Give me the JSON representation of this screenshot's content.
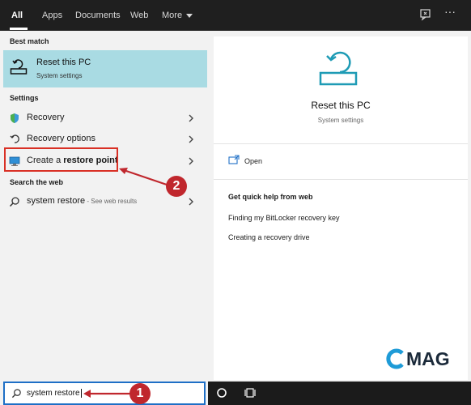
{
  "tabs": [
    {
      "label": "All",
      "active": true
    },
    {
      "label": "Apps",
      "active": false
    },
    {
      "label": "Documents",
      "active": false
    },
    {
      "label": "Web",
      "active": false
    },
    {
      "label": "More",
      "active": false
    }
  ],
  "top_icons": [
    "feedback-icon",
    "more-options-icon"
  ],
  "top_more_icon_text": "···",
  "left": {
    "best_match_heading": "Best match",
    "best_match": {
      "title": "Reset this PC",
      "subtitle": "System settings",
      "icon": "reset-pc-icon"
    },
    "settings_heading": "Settings",
    "settings_items": [
      {
        "label": "Recovery",
        "icon": "recovery-shield-icon"
      },
      {
        "label": "Recovery options",
        "icon": "recovery-options-icon"
      },
      {
        "label_prefix": "Create a ",
        "label_bold": "restore point",
        "icon": "system-properties-icon"
      }
    ],
    "web_heading": "Search the web",
    "web_item": {
      "label": "system restore",
      "suffix": " - See web results",
      "icon": "search-icon"
    }
  },
  "right": {
    "title": "Reset this PC",
    "subtitle": "System settings",
    "open_label": "Open",
    "help_heading": "Get quick help from web",
    "help_links": [
      "Finding my BitLocker recovery key",
      "Creating a recovery drive"
    ]
  },
  "search": {
    "value": "system restore",
    "icon": "search-icon"
  },
  "taskbar_icons": [
    "cortana-icon",
    "task-view-icon"
  ],
  "annotations": [
    {
      "number": "1"
    },
    {
      "number": "2"
    }
  ],
  "watermark": {
    "text": "MAG"
  },
  "colors": {
    "best_match_bg": "#a9dbe3",
    "accent": "#1e6fc6",
    "annotation_red": "#c0272d",
    "topbar": "#1f1f1f"
  }
}
